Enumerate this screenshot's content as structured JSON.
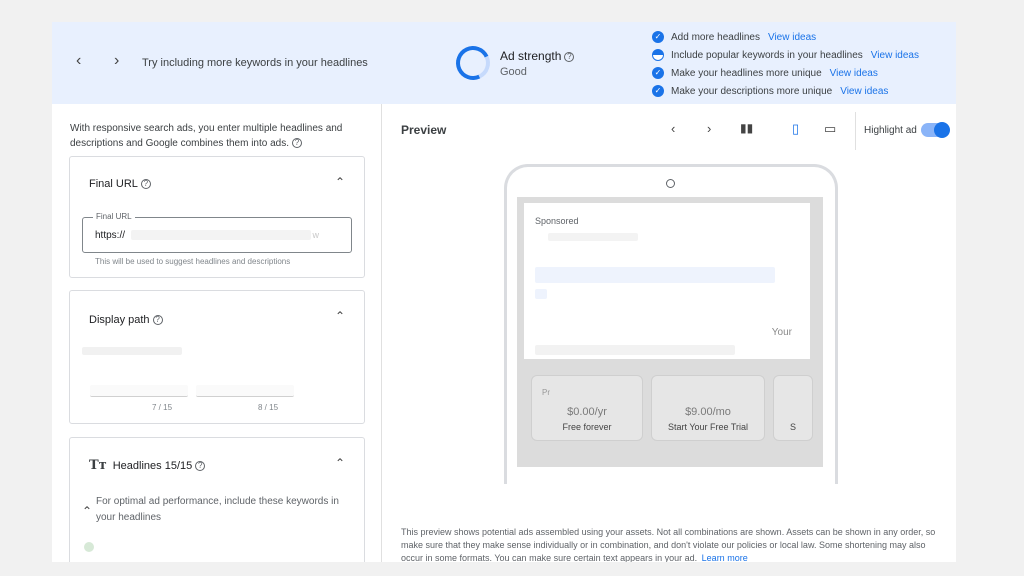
{
  "banner": {
    "tip": "Try including more keywords in your headlines",
    "strength_label": "Ad strength",
    "strength_value": "Good",
    "checklist": [
      {
        "text": "Add more headlines",
        "link": "View ideas",
        "state": "done"
      },
      {
        "text": "Include popular keywords in your headlines",
        "link": "View ideas",
        "state": "partial"
      },
      {
        "text": "Make your headlines more unique",
        "link": "View ideas",
        "state": "done"
      },
      {
        "text": "Make your descriptions more unique",
        "link": "View ideas",
        "state": "done"
      }
    ]
  },
  "left": {
    "intro": "With responsive search ads, you enter multiple headlines and descriptions and Google combines them into ads.",
    "final_url": {
      "title": "Final URL",
      "field_label": "Final URL",
      "value": "https://",
      "hint": "This will be used to suggest headlines and descriptions"
    },
    "display_path": {
      "title": "Display path",
      "counter1": "7 / 15",
      "counter2": "8 / 15"
    },
    "headlines": {
      "title": "Headlines 15/15",
      "tip": "For optimal ad performance, include these keywords in your headlines"
    }
  },
  "preview": {
    "title": "Preview",
    "highlight_label": "Highlight ad",
    "highlight_on": true,
    "ad": {
      "sponsored": "Sponsored",
      "tail": "Your"
    },
    "sitelinks": [
      {
        "price": "$0.00/yr",
        "label": "Free forever"
      },
      {
        "price": "$9.00/mo",
        "label": "Start Your Free Trial"
      },
      {
        "price": "",
        "label": "S"
      }
    ],
    "sitelink_prefix": "Pr",
    "disclaimer": "This preview shows potential ads assembled using your assets. Not all combinations are shown. Assets can be shown in any order, so make sure that they make sense individually or in combination, and don't violate our policies or local law. Some shortening may also occur in some formats. You can make sure certain text appears in your ad.",
    "learn_more": "Learn more"
  },
  "colors": {
    "accent": "#1a73e8",
    "banner_bg": "#e8f0fe"
  },
  "icons": {
    "prev": "chevron-left-icon",
    "next": "chevron-right-icon",
    "help": "help-circle-icon",
    "collapse": "chevron-up-icon",
    "columns": "columns-icon",
    "mobile": "phone-icon",
    "desktop": "laptop-icon",
    "text": "text-format-icon"
  }
}
